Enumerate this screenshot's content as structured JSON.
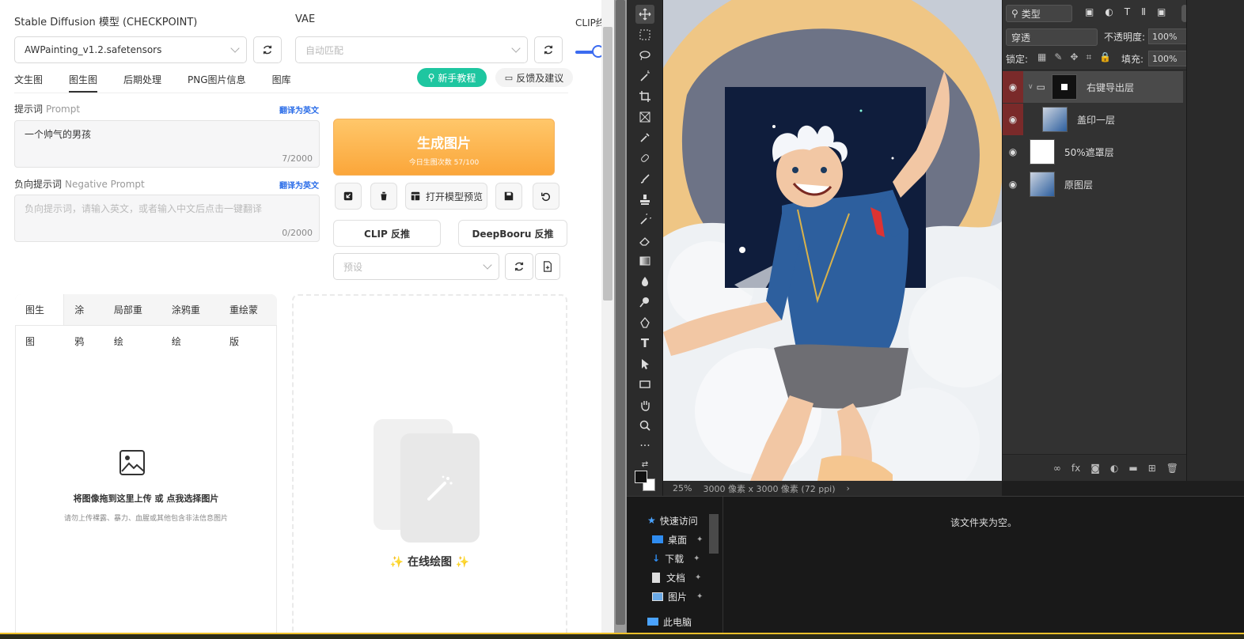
{
  "sd": {
    "checkpoint_label": "Stable Diffusion 模型 (CHECKPOINT)",
    "checkpoint_value": "AWPainting_v1.2.safetensors",
    "vae_label": "VAE",
    "vae_value": "自动匹配",
    "clip_label": "CLIP终",
    "tabs": [
      "文生图",
      "图生图",
      "后期处理",
      "PNG图片信息",
      "图库"
    ],
    "active_tab": "图生图",
    "tutorial_btn": "新手教程",
    "feedback_btn": "反馈及建议",
    "prompt_label": "提示词",
    "prompt_sub": "Prompt",
    "translate_link": "翻译为英文",
    "prompt_value": "一个帅气的男孩",
    "prompt_count": "7/2000",
    "neg_label": "负向提示词",
    "neg_sub": "Negative Prompt",
    "neg_placeholder": "负向提示词，请输入英文，或者输入中文后点击一键翻译",
    "neg_count": "0/2000",
    "generate_label": "生成图片",
    "generate_count": "今日生图次数 57/100",
    "open_preview_btn": "打开模型预览",
    "clip_btn": "CLIP 反推",
    "deepbooru_btn": "DeepBooru 反推",
    "preset_placeholder": "预设",
    "subtabs": [
      "图生图",
      "涂鸦",
      "局部重绘",
      "涂鸦重绘",
      "重绘蒙版"
    ],
    "upload_title": "将图像拖到这里上传 或 点我选择图片",
    "upload_hint": "请勿上传裸露、暴力、血腥或其他包含非法信息图片",
    "online_draw": "在线绘图"
  },
  "ps": {
    "filter_kind": "类型",
    "blend_mode": "穿透",
    "opacity_label": "不透明度:",
    "opacity_value": "100%",
    "lock_label": "锁定:",
    "fill_label": "填充:",
    "fill_value": "100%",
    "layers": [
      {
        "name": "右键导出层"
      },
      {
        "name": "盖印一层"
      },
      {
        "name": "50%遮罩层"
      },
      {
        "name": "原图层"
      }
    ],
    "zoom": "25%",
    "doc_info": "3000 像素 x 3000 像素 (72 ppi)",
    "explorer_empty": "该文件夹为空。",
    "nav": [
      "快速访问",
      "桌面",
      "下载",
      "文档",
      "图片",
      "此电脑"
    ]
  },
  "colors": {
    "accent_green": "#1ec6a0",
    "generate_orange": "#fba63a",
    "ps_dark": "#323232"
  }
}
